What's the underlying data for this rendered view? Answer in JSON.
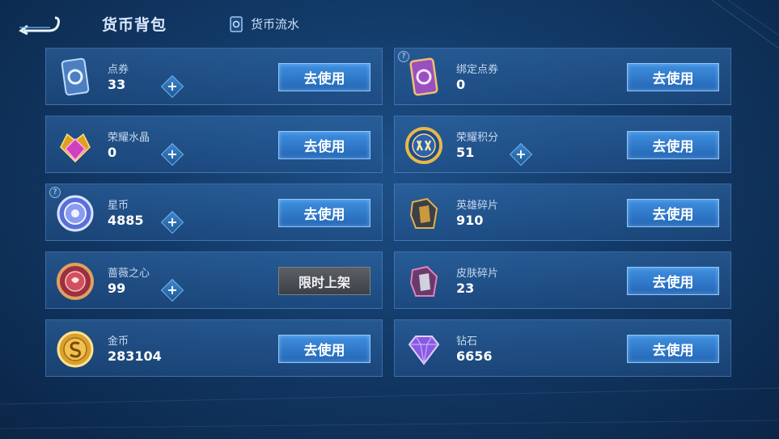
{
  "header": {
    "title": "货币背包",
    "flow_label": "货币流水",
    "back_icon": "back-arrow-icon"
  },
  "currencies": [
    {
      "id": "dianjuan",
      "name": "点券",
      "amount": "33",
      "plus": true,
      "action": "去使用",
      "icon": "coupon-card-icon",
      "help": false
    },
    {
      "id": "bangding",
      "name": "绑定点券",
      "amount": "0",
      "plus": false,
      "action": "去使用",
      "icon": "bound-coupon-card-icon",
      "help": true
    },
    {
      "id": "shuijing",
      "name": "荣耀水晶",
      "amount": "0",
      "plus": true,
      "action": "去使用",
      "icon": "glory-crystal-icon",
      "help": false
    },
    {
      "id": "jifen",
      "name": "荣耀积分",
      "amount": "51",
      "plus": true,
      "action": "去使用",
      "icon": "glory-points-coin-icon",
      "help": false
    },
    {
      "id": "xingbi",
      "name": "星币",
      "amount": "4885",
      "plus": true,
      "action": "去使用",
      "icon": "star-coin-icon",
      "help": true
    },
    {
      "id": "yingxiong",
      "name": "英雄碎片",
      "amount": "910",
      "plus": false,
      "action": "去使用",
      "icon": "hero-fragment-icon",
      "help": false
    },
    {
      "id": "qiangwei",
      "name": "蔷薇之心",
      "amount": "99",
      "plus": true,
      "action": "限时上架",
      "icon": "rose-heart-icon",
      "help": false
    },
    {
      "id": "pifu",
      "name": "皮肤碎片",
      "amount": "23",
      "plus": false,
      "action": "去使用",
      "icon": "skin-fragment-icon",
      "help": false
    },
    {
      "id": "jinbi",
      "name": "金币",
      "amount": "283104",
      "plus": false,
      "action": "去使用",
      "icon": "gold-coin-icon",
      "help": false
    },
    {
      "id": "zuanshi",
      "name": "钻石",
      "amount": "6656",
      "plus": false,
      "action": "去使用",
      "icon": "diamond-icon",
      "help": false
    }
  ],
  "help_mark": "?",
  "plus_symbol": "+"
}
